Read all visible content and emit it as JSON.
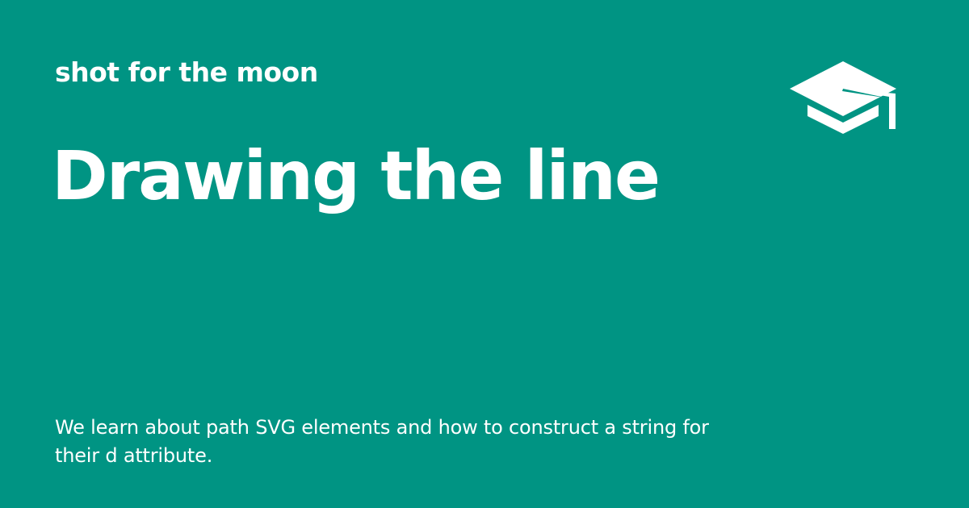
{
  "site": {
    "name": "shot for the moon"
  },
  "post": {
    "title": "Drawing the line",
    "description": "We learn about path SVG elements and how to construct a string for their d attribute."
  },
  "logo": {
    "icon": "graduation-cap-icon"
  },
  "colors": {
    "background": "#009483",
    "foreground": "#ffffff"
  }
}
